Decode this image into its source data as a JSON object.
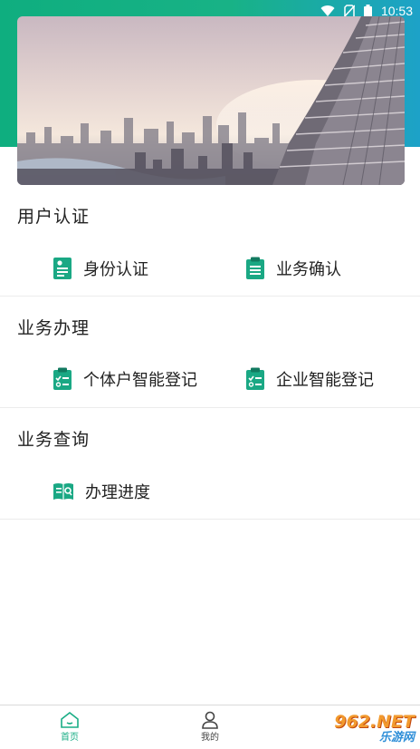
{
  "status_bar": {
    "time": "10:53"
  },
  "sections": [
    {
      "title": "用户认证",
      "items": [
        {
          "label": "身份认证",
          "icon": "id-card-icon"
        },
        {
          "label": "业务确认",
          "icon": "clipboard-list-icon"
        }
      ]
    },
    {
      "title": "业务办理",
      "items": [
        {
          "label": "个体户智能登记",
          "icon": "checklist-icon"
        },
        {
          "label": "企业智能登记",
          "icon": "checklist-icon"
        }
      ]
    },
    {
      "title": "业务查询",
      "items": [
        {
          "label": "办理进度",
          "icon": "book-search-icon"
        }
      ]
    }
  ],
  "tabbar": {
    "home_label": "首页",
    "mine_label": "我的"
  },
  "watermark": {
    "brand": "962.NET",
    "text": "乐游网"
  },
  "colors": {
    "accent": "#19ad85",
    "header_start": "#0fae7f",
    "header_end": "#1da2c8"
  }
}
